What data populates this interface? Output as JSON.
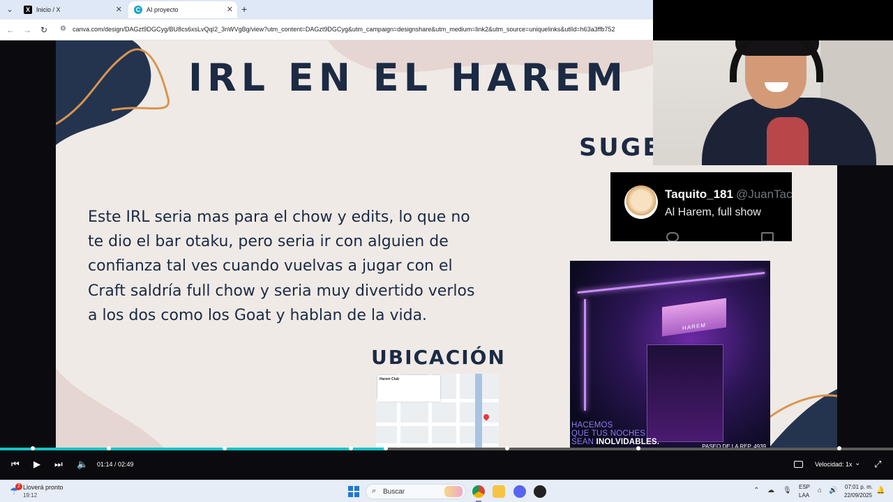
{
  "browser": {
    "tabs": [
      {
        "label": "Inicio / X",
        "active": false,
        "icon": "x-logo-icon"
      },
      {
        "label": "AI proyecto",
        "active": true,
        "icon": "canva-icon"
      }
    ],
    "url": "canva.com/design/DAGzt9DGCyg/BU8cs6xsLvQqI2_3nWVgBg/view?utm_content=DAGzt9DGCyg&utm_campaign=designshare&utm_medium=link2&utm_source=uniquelinks&utlId=h63a3ffb752"
  },
  "slide": {
    "title": "IRL EN EL HAREM",
    "sugerencia_heading": "SUGE",
    "body": "Este IRL seria mas para el chow y edits, lo que no te dio el bar otaku, pero seria ir con alguien de confianza tal ves cuando vuelvas a jugar con el Craft saldría full chow y seria muy divertido verlos a los dos como los Goat y hablan de la vida.",
    "ubicacion_heading": "UBICACIÓN",
    "tweet": {
      "name": "Taquito_181",
      "handle": "@JuanTac",
      "text": "Al Harem, full show"
    },
    "club_photo": {
      "sign": "HAREM",
      "tagline_1": "HACEMOS",
      "tagline_2": "QUE TUS NOCHES",
      "tagline_3a": "SEAN",
      "tagline_3b": "INOLVIDABLES.",
      "address": "PASEO DE LA REP. 4939"
    },
    "map": {
      "place_name": "Harem Club"
    },
    "colors": {
      "navy": "#1c2a44",
      "background": "#efeae6",
      "accent_orange": "#d9954f"
    }
  },
  "player": {
    "time": "01:14 / 02:49",
    "progress_fraction": 0.432,
    "speed_label": "Velocidad: 1x"
  },
  "taskbar": {
    "weather_badge": "2",
    "weather_title": "Lloverá pronto",
    "weather_time": "19:12",
    "search_placeholder": "Buscar",
    "lang_1": "ESP",
    "lang_2": "LAA",
    "clock_time": "07:01 p. m.",
    "clock_date": "22/09/2025"
  }
}
